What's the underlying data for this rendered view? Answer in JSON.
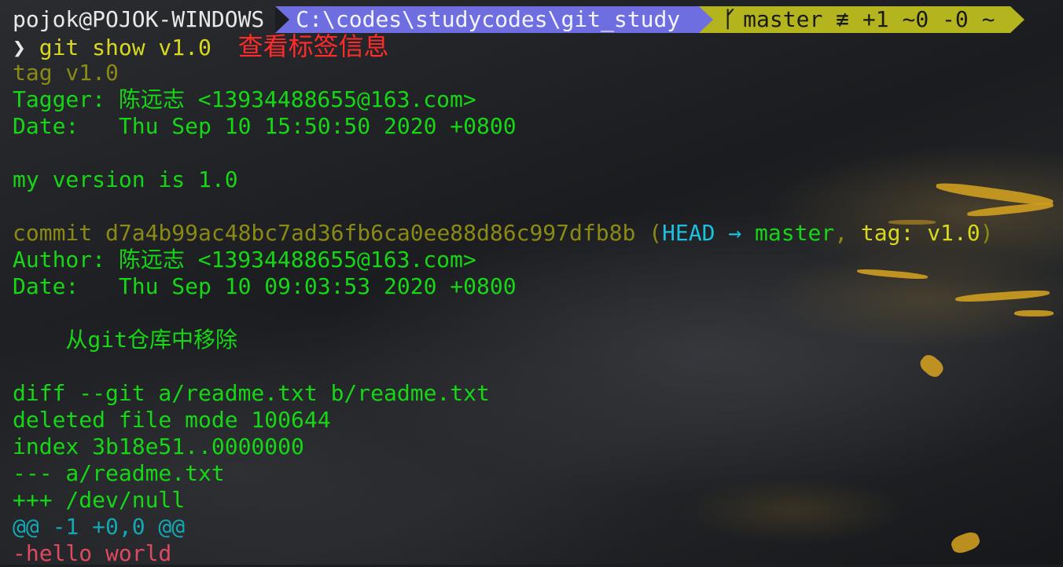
{
  "prompt": {
    "user": "pojok@POJOK-WINDOWS",
    "path": "C:\\codes\\studycodes\\git_study",
    "branch_icon": "git-branch-icon",
    "git_status": "master ≢ +1 ~0 -0 ~",
    "chevron": "❯"
  },
  "command": {
    "text": "git show v1.0",
    "annotation": "查看标签信息"
  },
  "tag": {
    "line": "tag v1.0",
    "tagger": "Tagger: 陈远志 <13934488655@163.com>",
    "date": "Date:   Thu Sep 10 15:50:50 2020 +0800",
    "message": "my version is 1.0"
  },
  "commit": {
    "prefix": "commit d7a4b99ac48bc7ad36fb6ca0ee88d86c997dfb8b (",
    "head": "HEAD",
    "arrow": " → ",
    "branch": "master",
    "sep": ", ",
    "tag": "tag: v1.0",
    "suffix": ")",
    "author": "Author: 陈远志 <13934488655@163.com>",
    "date": "Date:   Thu Sep 10 09:03:53 2020 +0800",
    "message": "    从git仓库中移除"
  },
  "diff": {
    "header": "diff --git a/readme.txt b/readme.txt",
    "mode": "deleted file mode 100644",
    "index": "index 3b18e51..0000000",
    "old_file": "--- a/readme.txt",
    "new_file": "+++ /dev/null",
    "hunk": "@@ -1 +0,0 @@",
    "removed": "-hello world"
  },
  "colors": {
    "text_green": "#16d616",
    "path_bg": "#6e6ee0",
    "git_bg": "#b4b41e",
    "annotation_red": "#ff2a2a"
  }
}
